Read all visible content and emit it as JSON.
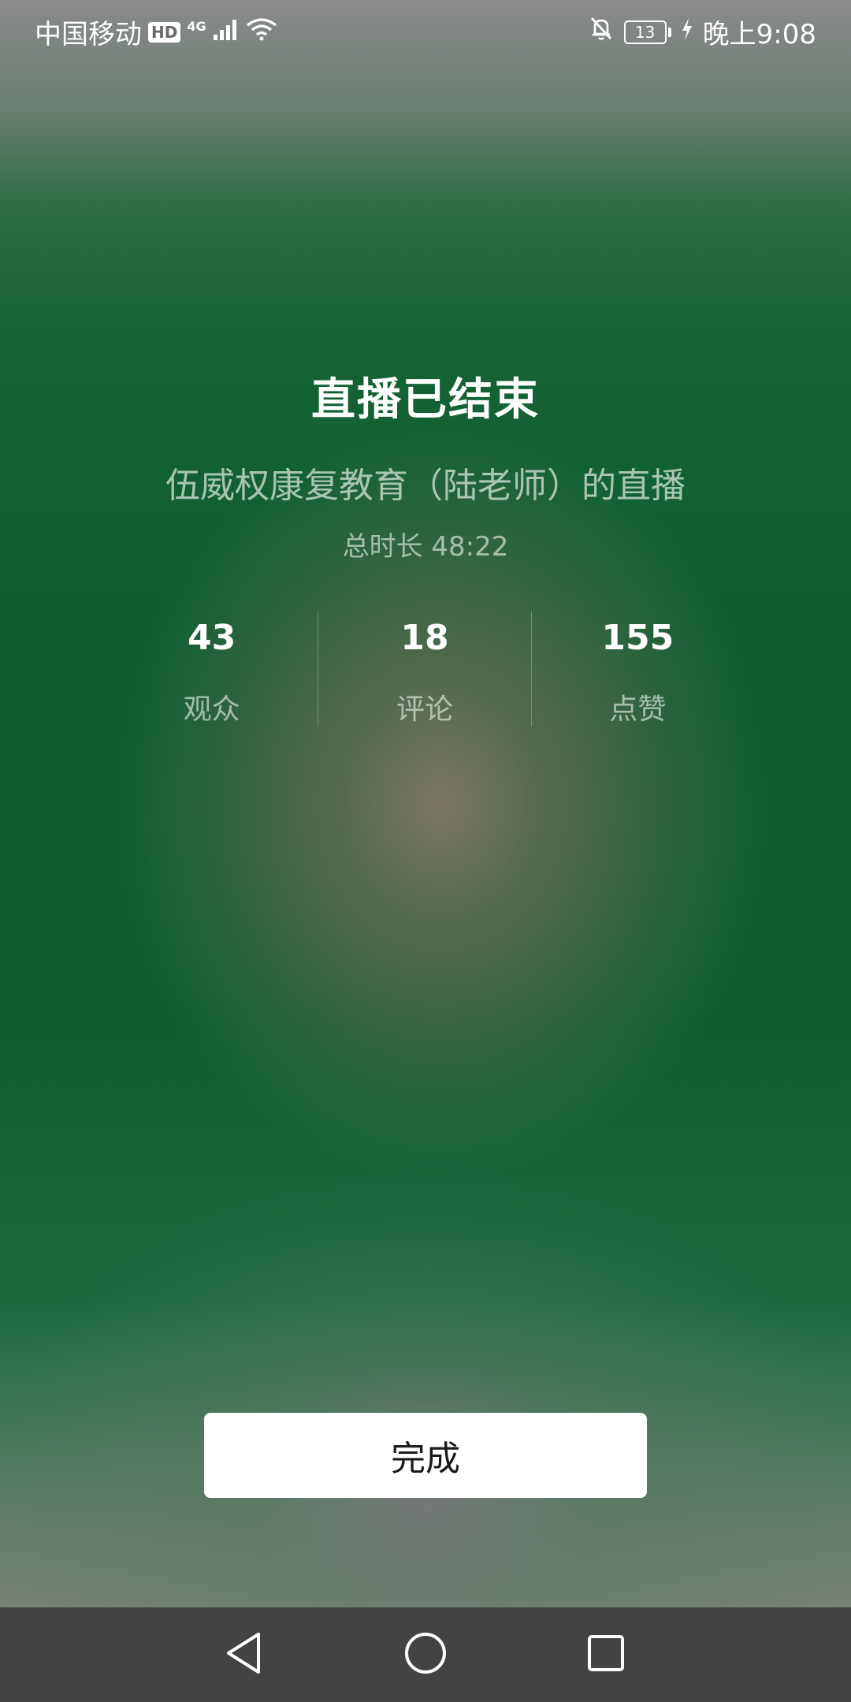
{
  "status_bar": {
    "carrier": "中国移动",
    "hd": "HD",
    "network": "4G",
    "battery": "13",
    "time": "晚上9:08"
  },
  "live_end": {
    "title": "直播已结束",
    "subtitle": "伍威权康复教育（陆老师）的直播",
    "duration_label": "总时长 48:22",
    "stats": [
      {
        "value": "43",
        "label": "观众"
      },
      {
        "value": "18",
        "label": "评论"
      },
      {
        "value": "155",
        "label": "点赞"
      }
    ],
    "done_label": "完成"
  },
  "colors": {
    "background": "#0f5a32",
    "button_bg": "#ffffff",
    "nav_bar": "#434343"
  },
  "icons": {
    "nav_back": "back-triangle-icon",
    "nav_home": "home-circle-icon",
    "nav_recent": "recent-square-icon"
  }
}
